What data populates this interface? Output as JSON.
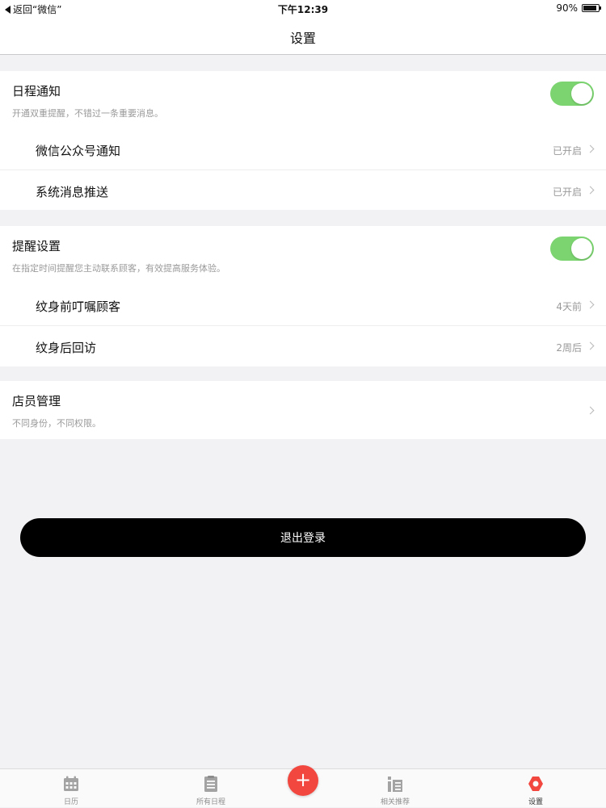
{
  "status_bar": {
    "back_label": "返回“微信”",
    "time": "下午12:39",
    "battery_text": "90%",
    "battery_level": 0.9
  },
  "nav": {
    "title": "设置"
  },
  "schedule_notice": {
    "title": "日程通知",
    "description": "开通双重提醒，不错过一条重要消息。",
    "enabled": true,
    "items": [
      {
        "label": "微信公众号通知",
        "value": "已开启"
      },
      {
        "label": "系统消息推送",
        "value": "已开启"
      }
    ]
  },
  "reminder_settings": {
    "title": "提醒设置",
    "description": "在指定时间提醒您主动联系顾客，有效提高服务体验。",
    "enabled": true,
    "items": [
      {
        "label": "纹身前叮嘱顾客",
        "value": "4天前"
      },
      {
        "label": "纹身后回访",
        "value": "2周后"
      }
    ]
  },
  "staff_management": {
    "title": "店员管理",
    "description": "不同身份，不同权限。"
  },
  "logout_label": "退出登录",
  "tabs": [
    {
      "label": "日历",
      "icon": "calendar-icon"
    },
    {
      "label": "所有日程",
      "icon": "list-icon"
    },
    {
      "label": "相关推荐",
      "icon": "recommend-icon"
    },
    {
      "label": "设置",
      "icon": "settings-icon",
      "active": true
    }
  ],
  "fab": {
    "symbol": "+",
    "icon": "add-icon"
  },
  "colors": {
    "toggle_on": "#7bd46f",
    "fab": "#f2473f",
    "settings_active": "#f2473f",
    "background": "#f2f1f4"
  }
}
